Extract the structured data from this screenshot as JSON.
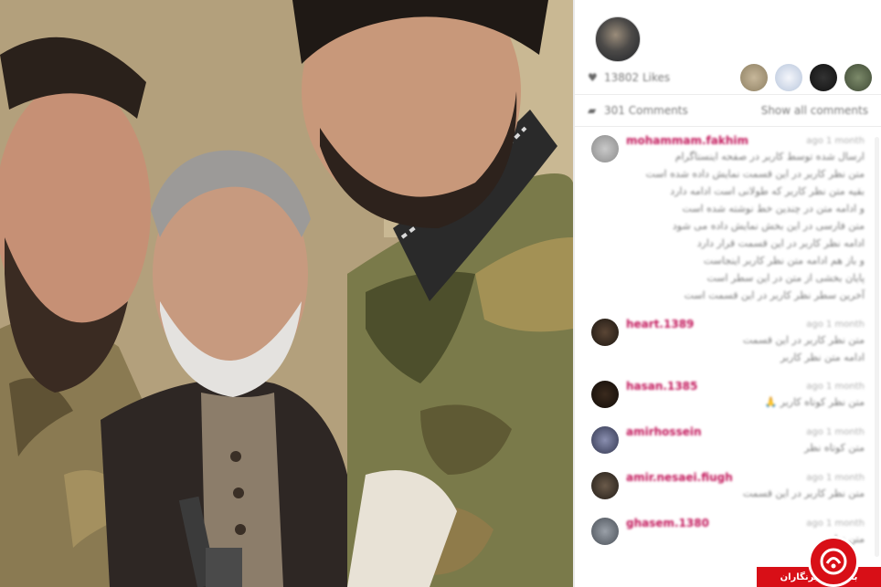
{
  "post": {
    "likes_text": "13802 Likes",
    "comments_text": "301 Comments",
    "show_all_label": "Show all comments",
    "colors": {
      "username": "#c2185b",
      "muted": "#7a7a7a"
    }
  },
  "comments": [
    {
      "username": "mohammam.fakhim",
      "time": "ago 1 month",
      "body": "ارسال شده توسط کاربر در صفحه اینستاگرام\nمتن نظر کاربر در این قسمت نمایش داده شده است\nبقیه متن نظر کاربر که طولانی است ادامه دارد\nو ادامه متن در چندین خط نوشته شده است\nمتن فارسی در این بخش نمایش داده می شود\nادامه نظر کاربر در این قسمت قرار دارد\nو باز هم ادامه متن نظر کاربر اینجاست\nپایان بخشی از متن در این سطر است\nآخرین سطر نظر کاربر در این قسمت است"
    },
    {
      "username": "heart.1389",
      "time": "ago 1 month",
      "body": "متن نظر کاربر در این قسمت\nادامه متن نظر کاربر"
    },
    {
      "username": "hasan.1385",
      "time": "ago 1 month",
      "body": "متن نظر کوتاه کاربر 🙏"
    },
    {
      "username": "amirhossein",
      "time": "ago 1 month",
      "body": "متن کوتاه نظر"
    },
    {
      "username": "amir.nesaei.fiugh",
      "time": "ago 1 month",
      "body": "متن نظر کاربر در این قسمت"
    },
    {
      "username": "ghasem.1380",
      "time": "ago 1 month",
      "body": "متن نظر"
    }
  ],
  "icons": {
    "likes": "heart-icon",
    "comments": "speech-bubble-icon"
  },
  "watermark": {
    "text": "باشگاه خبرنگاران",
    "color": "#d80f17"
  }
}
